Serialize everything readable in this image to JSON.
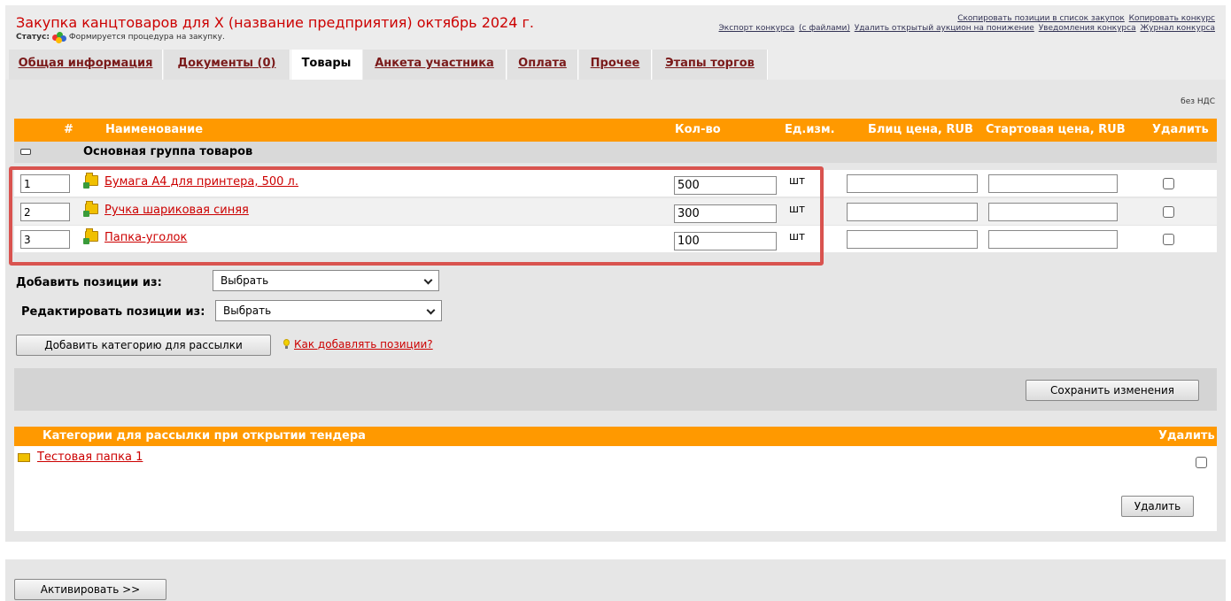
{
  "header": {
    "title": "Закупка канцтоваров для Х (название предприятия) октябрь 2024 г.",
    "status_label": "Статус:",
    "status_text": "Формируется процедура на закупку.",
    "links_row1": [
      "Скопировать позиции в список закупок",
      "Копировать конкурс"
    ],
    "links_row2": [
      "Экспорт конкурса",
      "(с файлами)",
      "Удалить открытый аукцион на понижение",
      "Уведомления конкурса",
      "Журнал конкурса"
    ]
  },
  "tabs": [
    {
      "label": "Общая информация"
    },
    {
      "label": "Документы (0)"
    },
    {
      "label": "Товары",
      "active": true
    },
    {
      "label": "Анкета участника"
    },
    {
      "label": "Оплата"
    },
    {
      "label": "Прочее"
    },
    {
      "label": "Этапы торгов"
    }
  ],
  "vat_note": "без НДС",
  "table": {
    "columns": {
      "num": "#",
      "name": "Наименование",
      "qty": "Кол-во",
      "unit": "Ед.изм.",
      "blitz": "Блиц цена, RUB",
      "start": "Стартовая цена, RUB",
      "delete": "Удалить"
    },
    "group_name": "Основная группа товаров",
    "items": [
      {
        "num": "1",
        "name": "Бумага А4 для принтера, 500 л.",
        "qty": "500",
        "unit": "шт"
      },
      {
        "num": "2",
        "name": "Ручка шариковая синяя",
        "qty": "300",
        "unit": "шт"
      },
      {
        "num": "3",
        "name": "Папка-уголок",
        "qty": "100",
        "unit": "шт"
      }
    ]
  },
  "add_positions": {
    "label": "Добавить позиции из:",
    "value": "Выбрать"
  },
  "edit_positions": {
    "label": "Редактировать позиции из:",
    "value": "Выбрать"
  },
  "add_category_button": "Добавить категорию для рассылки",
  "help_link": "Как добавлять позиции?",
  "save_button": "Сохранить изменения",
  "categories": {
    "header": "Категории для рассылки при открытии тендера",
    "delete_header": "Удалить",
    "items": [
      {
        "name": "Тестовая папка 1"
      }
    ],
    "delete_button": "Удалить"
  },
  "activate_button": "Активировать >>",
  "colors": {
    "accent": "#ff9900",
    "link": "#cc0000",
    "highlight": "#d9534f"
  }
}
